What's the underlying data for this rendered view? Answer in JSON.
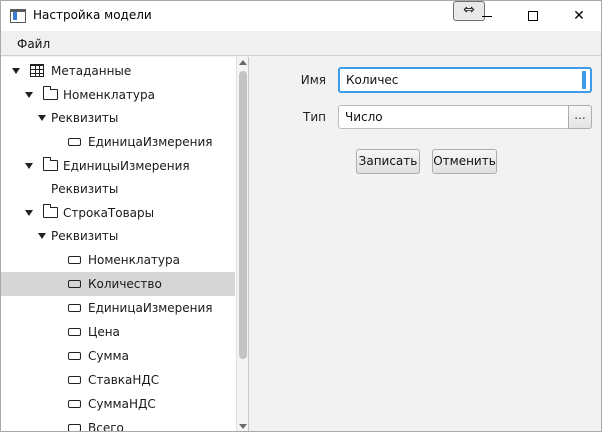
{
  "window": {
    "title": "Настройка модели",
    "resize_glyph": "⇔"
  },
  "menu": {
    "items": [
      "Файл"
    ]
  },
  "tree": {
    "rows": [
      {
        "label": "Метаданные",
        "icon": "grid-icon",
        "expanded": true
      },
      {
        "label": "Номенклатура",
        "icon": "folder-icon",
        "expanded": true
      },
      {
        "label": "Реквизиты",
        "icon": "none",
        "expanded": true
      },
      {
        "label": "ЕдиницаИзмерения",
        "icon": "field-icon"
      },
      {
        "label": "ЕдиницыИзмерения",
        "icon": "folder-icon",
        "expanded": true
      },
      {
        "label": "Реквизиты",
        "icon": "none"
      },
      {
        "label": "СтрокаТовары",
        "icon": "folder-icon",
        "expanded": true
      },
      {
        "label": "Реквизиты",
        "icon": "none",
        "expanded": true
      },
      {
        "label": "Номенклатура",
        "icon": "field-icon"
      },
      {
        "label": "Количество",
        "icon": "field-icon",
        "selected": true
      },
      {
        "label": "ЕдиницаИзмерения",
        "icon": "field-icon"
      },
      {
        "label": "Цена",
        "icon": "field-icon"
      },
      {
        "label": "Сумма",
        "icon": "field-icon"
      },
      {
        "label": "СтавкаНДС",
        "icon": "field-icon"
      },
      {
        "label": "СуммаНДС",
        "icon": "field-icon"
      },
      {
        "label": "Всего",
        "icon": "field-icon"
      }
    ]
  },
  "form": {
    "name_label": "Имя",
    "name_value": "Количес",
    "type_label": "Тип",
    "type_value": "Число",
    "type_button": "...",
    "save_button": "Записать",
    "cancel_button": "Отменить"
  },
  "colors": {
    "accent": "#3d9be9",
    "selection": "#d6d6d6"
  }
}
